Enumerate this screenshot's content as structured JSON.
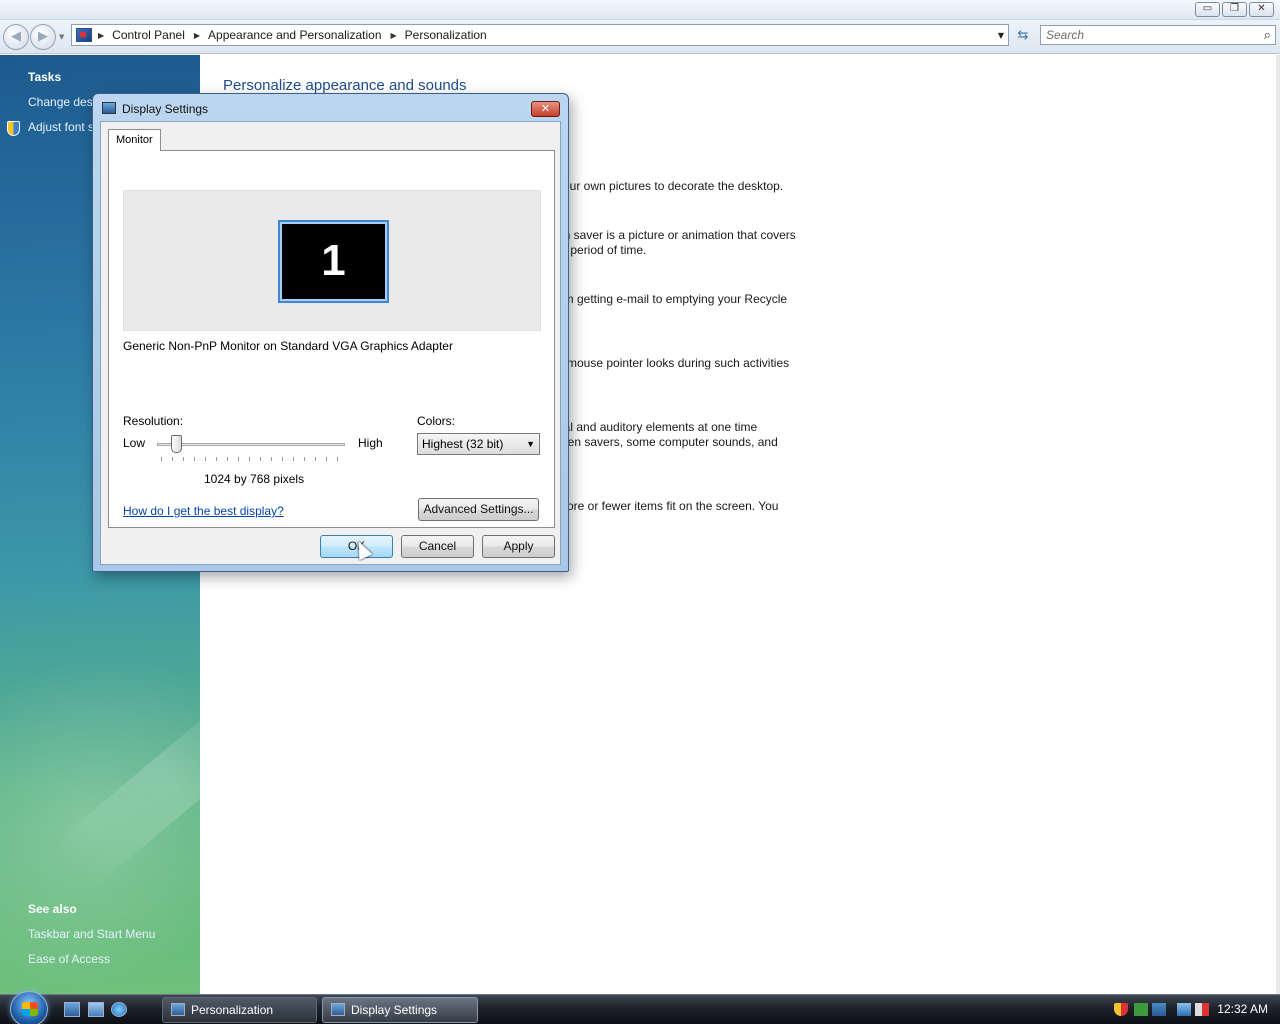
{
  "window": {
    "min_glyph": "▭",
    "max_glyph": "❐",
    "close_glyph": "✕"
  },
  "address": {
    "breadcrumbs": [
      "Control Panel",
      "Appearance and Personalization",
      "Personalization"
    ],
    "search_placeholder": "Search"
  },
  "left_pane": {
    "tasks_heading": "Tasks",
    "task_links": [
      "Change desi",
      "Adjust font s"
    ],
    "see_also_heading": "See also",
    "see_also_links": [
      "Taskbar and Start Menu",
      "Ease of Access"
    ]
  },
  "content": {
    "title": "Personalize appearance and sounds",
    "descriptions": [
      [
        "your own pictures to decorate the desktop."
      ],
      [
        "en saver is a picture or animation that covers",
        "et period of time."
      ],
      [
        "om getting e-mail to emptying your Recycle"
      ],
      [
        "e mouse pointer looks during such activities"
      ],
      [
        "ual and auditory elements at one time",
        "reen savers, some computer sounds, and"
      ],
      [
        "more or fewer items fit on the screen. You"
      ]
    ]
  },
  "dialog": {
    "title": "Display Settings",
    "tab_label": "Monitor",
    "monitor_number": "1",
    "monitor_name": "Generic Non-PnP Monitor on Standard VGA Graphics Adapter",
    "resolution_label": "Resolution:",
    "low_label": "Low",
    "high_label": "High",
    "resolution_value": "1024 by 768 pixels",
    "resolution_slider_level": 0.08,
    "colors_label": "Colors:",
    "colors_value": "Highest (32 bit)",
    "help_link": "How do I get the best display?",
    "advanced_button": "Advanced Settings...",
    "ok_button": "OK",
    "cancel_button": "Cancel",
    "apply_button": "Apply"
  },
  "taskbar": {
    "buttons": [
      "Personalization",
      "Display Settings"
    ],
    "clock": "12:32 AM"
  },
  "colors": {
    "link": "#0645ad",
    "title_blue": "#1e4c8f",
    "close_red": "#c5402a"
  }
}
